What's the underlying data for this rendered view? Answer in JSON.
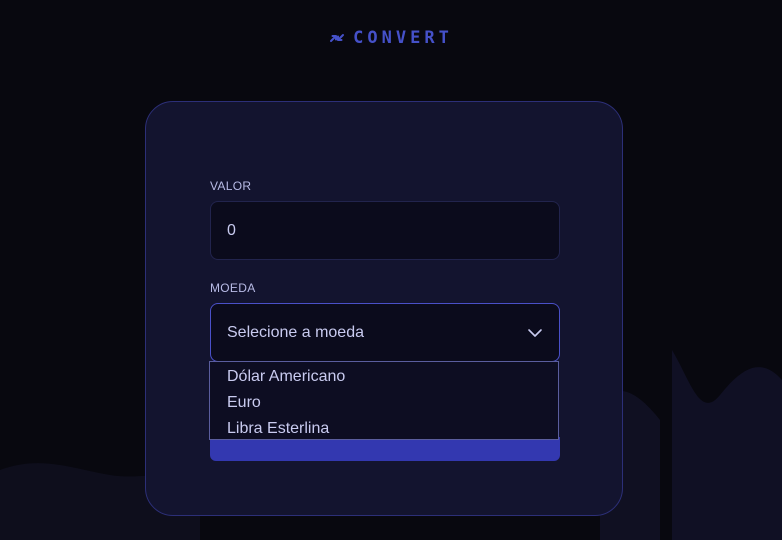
{
  "brand": {
    "name": "CONVERT",
    "icon": "arrows-exchange-icon",
    "color": "#4551c9"
  },
  "form": {
    "value_label": "VALOR",
    "value_input": "0",
    "currency_label": "MOEDA",
    "currency_placeholder": "Selecione a moeda",
    "currency_options": [
      "Dólar Americano",
      "Euro",
      "Libra Esterlina"
    ]
  },
  "colors": {
    "background": "#08080f",
    "card": "#13142f",
    "accent": "#3338b0"
  }
}
